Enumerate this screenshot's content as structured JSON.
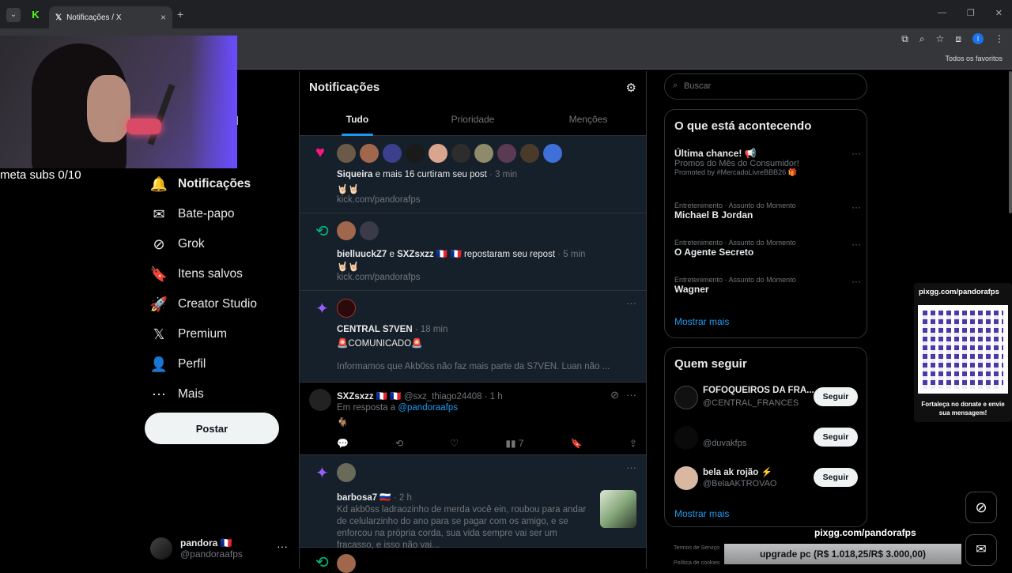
{
  "browser": {
    "tab_title": "Notificações / X",
    "bookmarks_all": "Todos os favoritos"
  },
  "stream": {
    "meta_subs": "meta subs 0/10",
    "partial_label": "al",
    "qr_title": "pixgg.com/pandorafps",
    "qr_caption": "Fortaleça no donate e envie sua mensagem!",
    "overlay_url": "pixgg.com/pandorafps",
    "upgrade_text": "upgrade pc (R$ 1.018,25/R$ 3.000,00)"
  },
  "sidebar": {
    "items": [
      {
        "label": "Notificações",
        "icon": "bell-icon"
      },
      {
        "label": "Bate-papo",
        "icon": "mail-icon"
      },
      {
        "label": "Grok",
        "icon": "grok-icon"
      },
      {
        "label": "Itens salvos",
        "icon": "bookmark-icon"
      },
      {
        "label": "Creator Studio",
        "icon": "rocket-icon"
      },
      {
        "label": "Premium",
        "icon": "x-logo-icon"
      },
      {
        "label": "Perfil",
        "icon": "person-icon"
      },
      {
        "label": "Mais",
        "icon": "more-circle-icon"
      }
    ],
    "post_label": "Postar",
    "account": {
      "name": "pandora 🇫🇷",
      "handle": "@pandoraafps"
    }
  },
  "main": {
    "title": "Notificações",
    "tabs": [
      "Tudo",
      "Prioridade",
      "Menções"
    ],
    "notifications": [
      {
        "user": "Siqueira",
        "action": " e mais 16 curtiram seu post",
        "time": " · 3 min",
        "emoji": "🤘🏻🤘🏻",
        "link": "kick.com/pandorafps"
      },
      {
        "user": "bielluuckZ7",
        "mid": " e ",
        "user2": "SXZsxzz 🇫🇷 🇫🇷",
        "action": " repostaram seu repost",
        "time": " · 5 min",
        "emoji": "🤘🏻🤘🏻",
        "link": "kick.com/pandorafps"
      },
      {
        "user": "CENTRAL S7VEN",
        "time": " · 18 min",
        "line1": "🚨COMUNICADO🚨",
        "line2": "Informamos que Akb0ss não faz mais parte da S7VEN. Luan não ..."
      },
      {
        "user": "SXZsxzz 🇫🇷 🇫🇷",
        "handle": " @sxz_thiago24408 · 1 h",
        "reply_prefix": "Em resposta a ",
        "reply_to": "@pandoraafps",
        "emoji": "🐐",
        "views": "7"
      },
      {
        "user": "barbosa7 🇷🇺",
        "time": " · 2 h",
        "text": "Kd akb0ss ladraozinho de merda você ein, roubou para andar de celularzinho do ano para se pagar com os amigo, e se enforcou na própria corda, sua vida sempre vai ser um fracasso, e isso não vai..."
      }
    ]
  },
  "right": {
    "search_placeholder": "Buscar",
    "trends_title": "O que está acontecendo",
    "trends": [
      {
        "title": "Última chance! 📢",
        "sub": "Promos do Mês do Consumidor!",
        "meta": "Promoted by #MercadoLivreBBB26 🎁"
      },
      {
        "meta": "Entretenimento · Assunto do Momento",
        "title": "Michael B Jordan"
      },
      {
        "meta": "Entretenimento · Assunto do Momento",
        "title": "O Agente Secreto"
      },
      {
        "meta": "Entretenimento · Assunto do Momento",
        "title": "Wagner"
      }
    ],
    "show_more": "Mostrar mais",
    "who_title": "Quem seguir",
    "who": [
      {
        "name": "FOFOQUEIROS DA FRA...",
        "handle": "@CENTRAL_FRANCES"
      },
      {
        "name": "",
        "handle": "@duvakfps"
      },
      {
        "name": "bela ak rojão ⚡",
        "handle": "@BelaAKTROVAO"
      }
    ],
    "follow_label": "Seguir",
    "footer1": "Termos de Serviço",
    "footer2": "Política de cookies"
  }
}
